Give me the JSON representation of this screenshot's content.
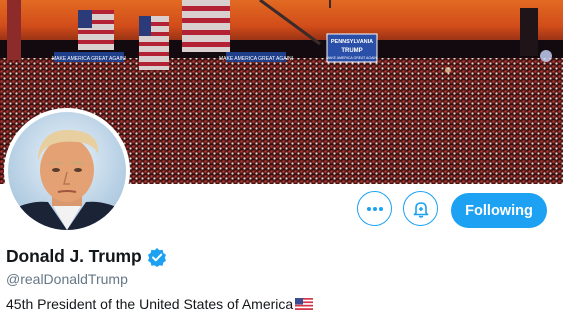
{
  "banner": {
    "description_icon": "rally-crowd-banner",
    "stage_sign": {
      "line1": "PENNSYLVANIA",
      "line2": "TRUMP",
      "line3": "MAKE AMERICA GREAT AGAIN!"
    },
    "side_signs": [
      "MAKE AMERICA GREAT AGAIN!",
      "MAKE AMERICA GREAT AGAIN!"
    ]
  },
  "profile": {
    "display_name": "Donald J. Trump",
    "handle": "@realDonaldTrump",
    "bio": "45th President of the United States of America",
    "bio_emoji_icon": "us-flag-icon",
    "verified_icon": "verified-badge-icon",
    "avatar_icon": "profile-avatar"
  },
  "actions": {
    "more_icon": "more-options-icon",
    "notify_icon": "bell-plus-icon",
    "follow_label": "Following"
  },
  "colors": {
    "accent": "#1da1f2",
    "text": "#14171a",
    "secondary_text": "#657786"
  }
}
